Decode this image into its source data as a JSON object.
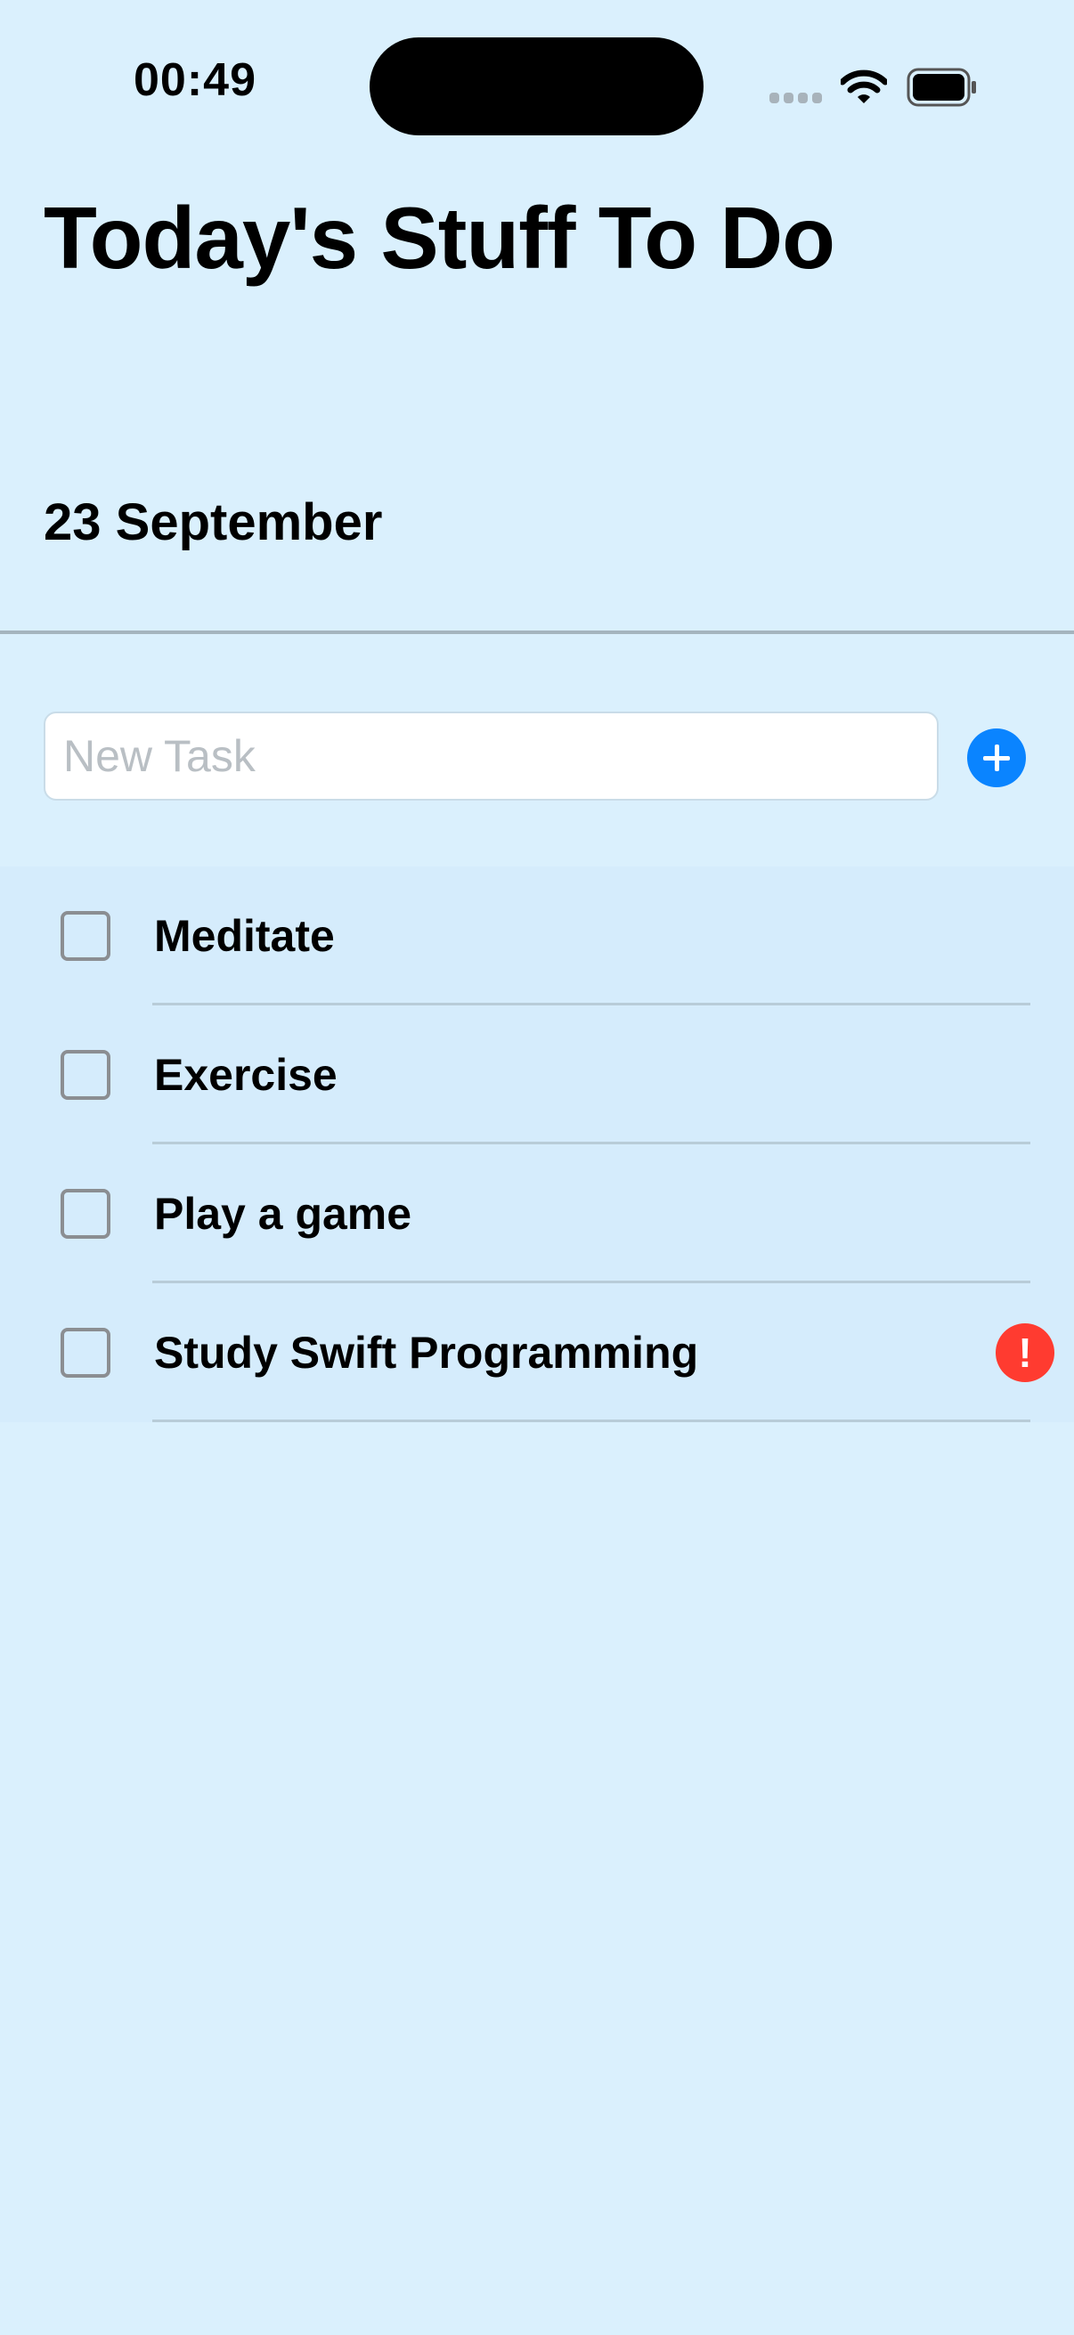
{
  "status_bar": {
    "time": "00:49",
    "icons": [
      "signal-icon",
      "wifi-icon",
      "battery-icon"
    ]
  },
  "header": {
    "title": "Today's Stuff To Do",
    "date": "23 September"
  },
  "new_task": {
    "placeholder": "New Task",
    "value": "",
    "add_icon": "plus-circle-icon"
  },
  "tasks": [
    {
      "label": "Meditate",
      "checked": false,
      "priority": false
    },
    {
      "label": "Exercise",
      "checked": false,
      "priority": false
    },
    {
      "label": "Play a game",
      "checked": false,
      "priority": false
    },
    {
      "label": "Study Swift Programming",
      "checked": false,
      "priority": true,
      "priority_symbol": "!"
    }
  ],
  "colors": {
    "background": "#daf0fd",
    "list_background": "#d5ecfc",
    "accent": "#0a84ff",
    "priority": "#ff3b30"
  }
}
